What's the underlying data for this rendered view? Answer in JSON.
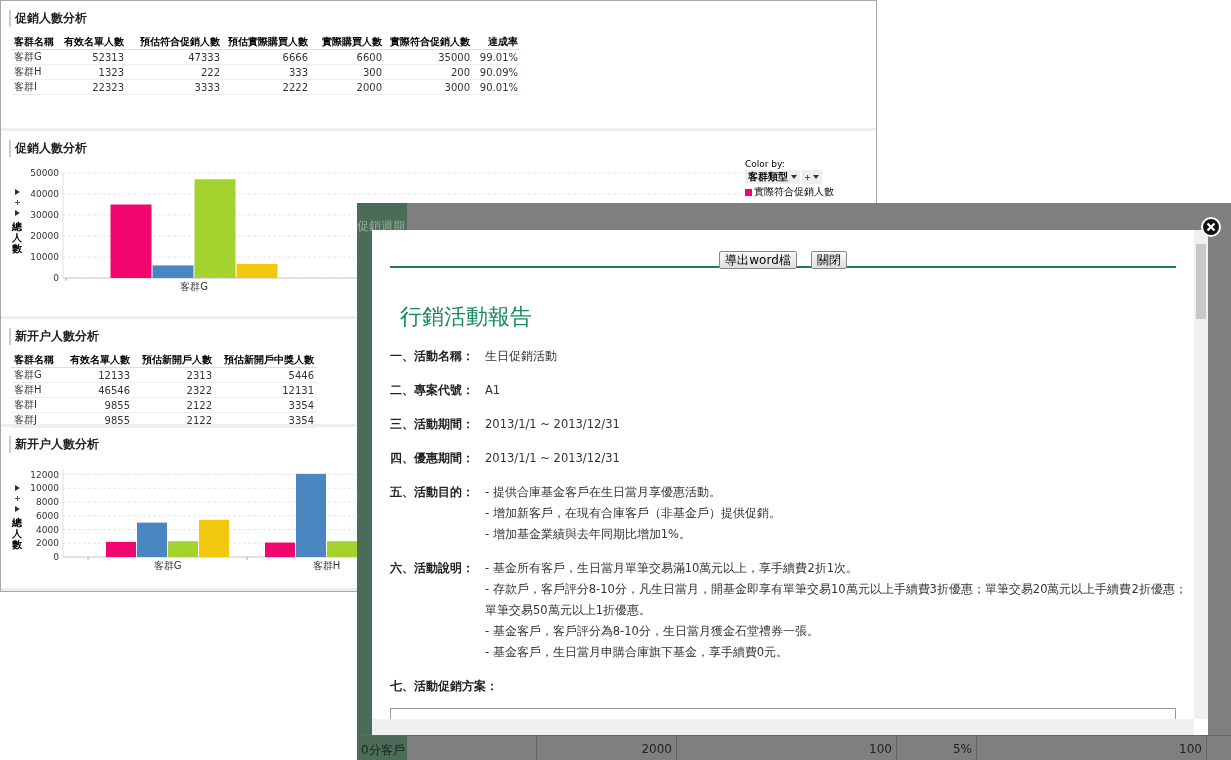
{
  "report": {
    "sections": [
      {
        "kind": "table",
        "title": "促銷人數分析",
        "columns": [
          "客群名稱",
          "有效名單人數",
          "預估符合促銷人數",
          "預估實際購買人數",
          "實際購買人數",
          "實際符合促銷人數",
          "達成率"
        ],
        "rows": [
          [
            "客群G",
            "52313",
            "47333",
            "6666",
            "6600",
            "35000",
            "99.01%"
          ],
          [
            "客群H",
            "1323",
            "222",
            "333",
            "300",
            "200",
            "90.09%"
          ],
          [
            "客群I",
            "22323",
            "3333",
            "2222",
            "2000",
            "3000",
            "90.01%"
          ]
        ]
      },
      {
        "kind": "chart",
        "title": "促銷人數分析",
        "color_by": {
          "label": "Color by:",
          "value": "客群類型"
        },
        "legend": [
          {
            "label": "實際符合促銷人數",
            "color": "#f0066e"
          }
        ],
        "chart_data": {
          "type": "bar",
          "ylabel": "總人數",
          "grid": true,
          "categories": [
            "客群G"
          ],
          "yticks": [
            0,
            10000,
            20000,
            30000,
            40000,
            50000
          ],
          "ylim": [
            0,
            50000
          ],
          "series": [
            {
              "color": "#f0066e",
              "values": [
                35000
              ]
            },
            {
              "color": "#4a86bf",
              "values": [
                6000
              ]
            },
            {
              "color": "#a4d22e",
              "values": [
                47000
              ]
            },
            {
              "color": "#f2c80f",
              "values": [
                6700
              ]
            }
          ]
        }
      },
      {
        "kind": "table",
        "title": "新开户人數分析",
        "columns": [
          "客群名稱",
          "有效名單人數",
          "預估新開戶人數",
          "預估新開戶中獎人數"
        ],
        "rows": [
          [
            "客群G",
            "12133",
            "2313",
            "5446"
          ],
          [
            "客群H",
            "46546",
            "2322",
            "12131"
          ],
          [
            "客群I",
            "9855",
            "2122",
            "3354"
          ],
          [
            "客群J",
            "9855",
            "2122",
            "3354"
          ]
        ]
      },
      {
        "kind": "chart",
        "title": "新开户人數分析",
        "chart_data": {
          "type": "bar",
          "ylabel": "總人數",
          "grid": true,
          "categories": [
            "客群G",
            "客群H"
          ],
          "yticks": [
            0,
            2000,
            4000,
            6000,
            8000,
            10000,
            12000
          ],
          "ylim": [
            0,
            12800
          ],
          "series": [
            {
              "color": "#f0066e",
              "values": [
                2200,
                2100
              ]
            },
            {
              "color": "#4a86bf",
              "values": [
                5000,
                12100
              ]
            },
            {
              "color": "#a4d22e",
              "values": [
                2300,
                2300
              ]
            },
            {
              "color": "#f2c80f",
              "values": [
                5400,
                null
              ]
            }
          ]
        }
      }
    ]
  },
  "dialog": {
    "background": {
      "side_label": "促銷週期",
      "bottom_row": [
        "0分客戶",
        "2000",
        "100",
        "5%",
        "100"
      ]
    },
    "buttons": [
      "導出word檔",
      "關閉"
    ],
    "title": "行銷活動報告",
    "items": [
      {
        "label": "一、活動名稱：",
        "lines": [
          "生日促銷活動"
        ]
      },
      {
        "label": "二、專案代號：",
        "lines": [
          "A1"
        ]
      },
      {
        "label": "三、活動期間：",
        "lines": [
          "2013/1/1 ~ 2013/12/31"
        ]
      },
      {
        "label": "四、優惠期間：",
        "lines": [
          "2013/1/1 ~ 2013/12/31"
        ]
      },
      {
        "label": "五、活動目的：",
        "lines": [
          "- 提供合庫基金客戶在生日當月享優惠活動。",
          "- 增加新客戶，在現有合庫客戶（非基金戶）提供促銷。",
          "- 增加基金業績與去年同期比增加1%。"
        ]
      },
      {
        "label": "六、活動說明：",
        "lines": [
          "- 基金所有客戶，生日當月單筆交易滿10萬元以上，享手續費2折1次。",
          "- 存款戶，客戶評分8-10分，凡生日當月，開基金即享有單筆交易10萬元以上手續費3折優惠；單筆交易20萬元以上手續費2折優惠；單筆交易50萬元以上1折優惠。",
          "- 基金客戶，客戶評分為8-10分，生日當月獲金石堂禮券一張。",
          "- 基金客戶，生日當月申購合庫旗下基金，享手續費0元。"
        ]
      },
      {
        "label": "七、活動促銷方案："
      }
    ]
  }
}
